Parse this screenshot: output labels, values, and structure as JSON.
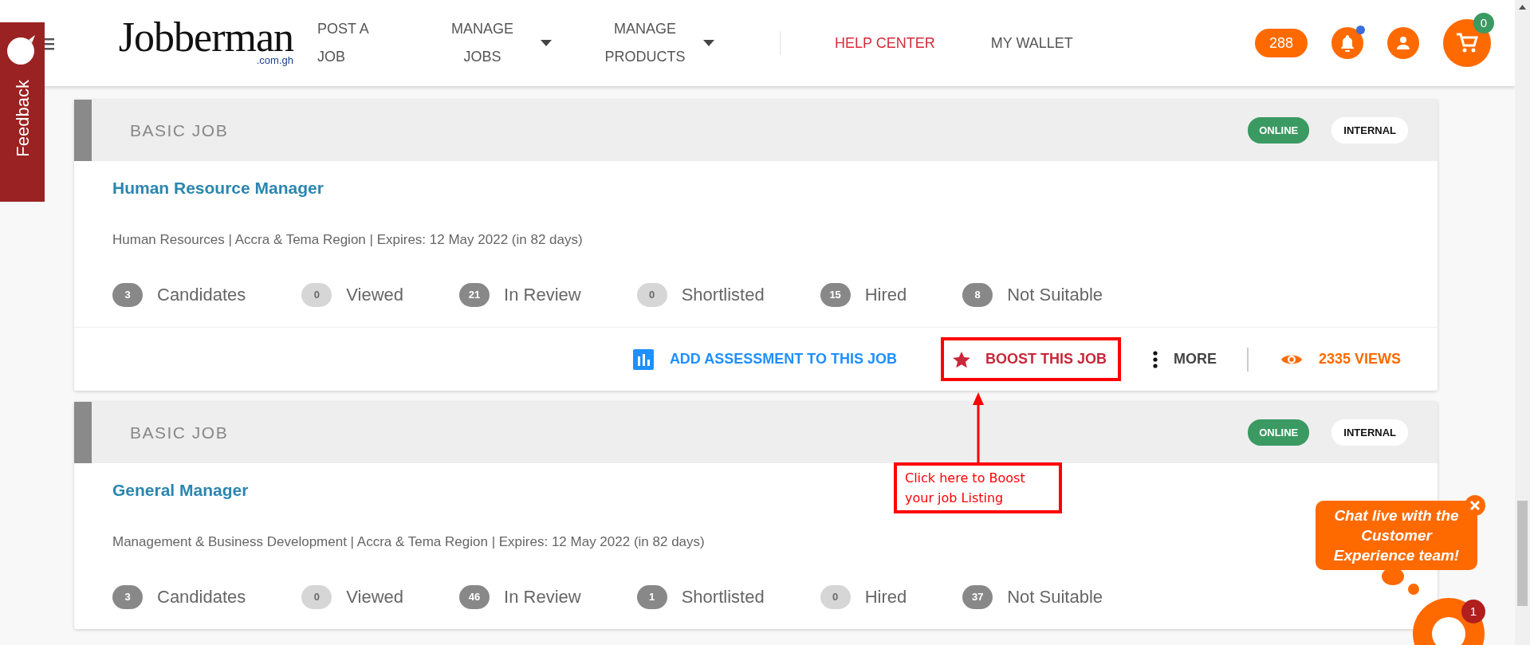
{
  "feedback_tab": {
    "label": "Feedback"
  },
  "header": {
    "logo": {
      "name": "Jobberman",
      "domain": ".com.gh"
    },
    "nav": [
      {
        "label": "POST A JOB",
        "dropdown": false,
        "highlighted": false
      },
      {
        "label": "MANAGE JOBS",
        "dropdown": true,
        "highlighted": false
      },
      {
        "label": "MANAGE PRODUCTS",
        "dropdown": true,
        "highlighted": false
      },
      {
        "label": "HELP CENTER",
        "dropdown": false,
        "highlighted": true
      },
      {
        "label": "MY WALLET",
        "dropdown": false,
        "highlighted": false
      }
    ],
    "credits": "288",
    "notifications_unread": true,
    "cart_count": "0"
  },
  "jobs": [
    {
      "type": "BASIC JOB",
      "status": "ONLINE",
      "visibility": "INTERNAL",
      "title": "Human Resource Manager",
      "meta": "Human Resources | Accra & Tema Region | Expires: 12 May 2022 (in 82 days)",
      "stats": [
        {
          "count": "3",
          "label": "Candidates",
          "muted": false
        },
        {
          "count": "0",
          "label": "Viewed",
          "muted": true
        },
        {
          "count": "21",
          "label": "In Review",
          "muted": false
        },
        {
          "count": "0",
          "label": "Shortlisted",
          "muted": true
        },
        {
          "count": "15",
          "label": "Hired",
          "muted": false
        },
        {
          "count": "8",
          "label": "Not Suitable",
          "muted": false
        }
      ],
      "actions": [
        {
          "kind": "assessment",
          "label": "ADD ASSESSMENT TO THIS JOB"
        },
        {
          "kind": "boost",
          "label": "BOOST THIS JOB"
        },
        {
          "kind": "more",
          "label": "MORE"
        },
        {
          "kind": "views",
          "label": "2335 VIEWS"
        }
      ]
    },
    {
      "type": "BASIC JOB",
      "status": "ONLINE",
      "visibility": "INTERNAL",
      "title": "General Manager",
      "meta": "Management & Business Development | Accra & Tema Region | Expires: 12 May 2022 (in 82 days)",
      "stats": [
        {
          "count": "3",
          "label": "Candidates",
          "muted": false
        },
        {
          "count": "0",
          "label": "Viewed",
          "muted": true
        },
        {
          "count": "46",
          "label": "In Review",
          "muted": false
        },
        {
          "count": "1",
          "label": "Shortlisted",
          "muted": false
        },
        {
          "count": "0",
          "label": "Hired",
          "muted": true
        },
        {
          "count": "37",
          "label": "Not Suitable",
          "muted": false
        }
      ]
    }
  ],
  "annotation": {
    "lines": [
      "Click here to Boost",
      "your job Listing"
    ]
  },
  "chat": {
    "message": "Chat live with the Customer Experience team!",
    "unread": "1"
  }
}
